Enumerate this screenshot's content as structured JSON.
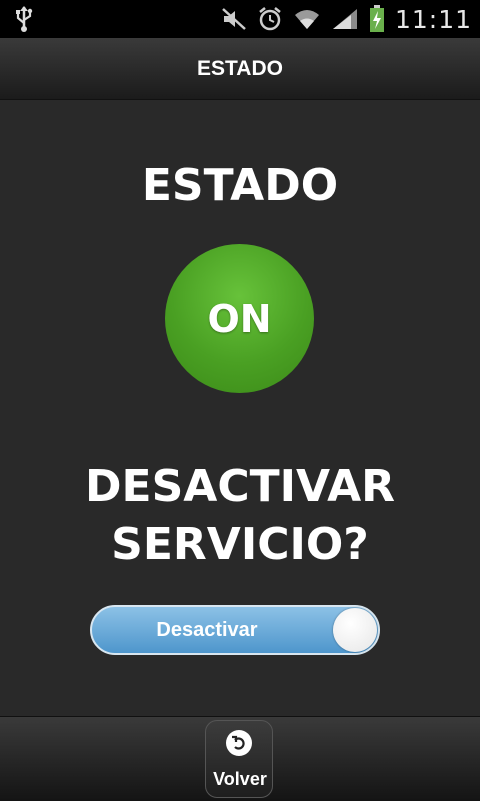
{
  "status_bar": {
    "clock": "11:11",
    "icons": [
      "usb-icon",
      "mute-icon",
      "alarm-icon",
      "wifi-icon",
      "signal-icon",
      "battery-charging-icon"
    ]
  },
  "header": {
    "title": "ESTADO"
  },
  "main": {
    "heading": "ESTADO",
    "status_indicator": {
      "text": "ON",
      "color": "#4aa023"
    },
    "question_line1": "DESACTIVAR",
    "question_line2": "SERVICIO?",
    "toggle": {
      "label": "Desactivar",
      "color": "#5a9fd4"
    }
  },
  "footer": {
    "back_label": "Volver",
    "icon": "back-arrow-icon"
  }
}
